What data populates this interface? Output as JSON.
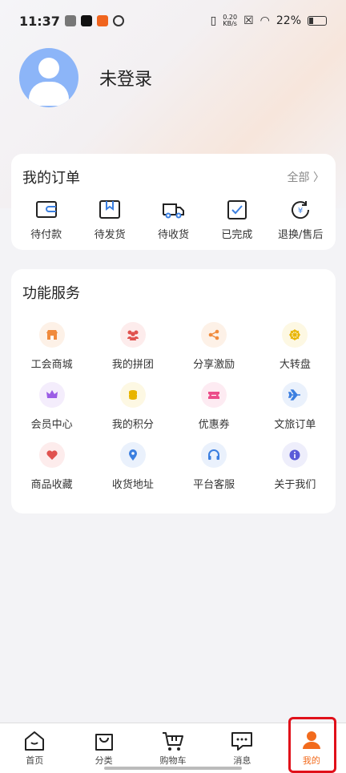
{
  "status_bar": {
    "time": "11:37",
    "net_speed_value": "0.20",
    "net_speed_unit": "KB/s",
    "battery": "22%"
  },
  "profile": {
    "login_text": "未登录"
  },
  "orders": {
    "title": "我的订单",
    "all_label": "全部 〉",
    "items": [
      {
        "label": "待付款",
        "icon": "wallet-icon"
      },
      {
        "label": "待发货",
        "icon": "package-icon"
      },
      {
        "label": "待收货",
        "icon": "truck-icon"
      },
      {
        "label": "已完成",
        "icon": "check-box-icon"
      },
      {
        "label": "退换/售后",
        "icon": "refund-icon"
      }
    ]
  },
  "services": {
    "title": "功能服务",
    "items": [
      {
        "label": "工会商城",
        "icon": "store-icon",
        "color": "#f08a3c",
        "bg": "#fdf1e7"
      },
      {
        "label": "我的拼团",
        "icon": "group-icon",
        "color": "#e0524f",
        "bg": "#fdecec"
      },
      {
        "label": "分享激励",
        "icon": "share-icon",
        "color": "#f08a3c",
        "bg": "#fdf1e7"
      },
      {
        "label": "大转盘",
        "icon": "wheel-icon",
        "color": "#e8b400",
        "bg": "#fdf8e3"
      },
      {
        "label": "会员中心",
        "icon": "crown-icon",
        "color": "#9b5de5",
        "bg": "#f4edfc"
      },
      {
        "label": "我的积分",
        "icon": "coins-icon",
        "color": "#e8b400",
        "bg": "#fdf8e3"
      },
      {
        "label": "优惠券",
        "icon": "coupon-icon",
        "color": "#ec4d8a",
        "bg": "#fdebf2"
      },
      {
        "label": "文旅订单",
        "icon": "plane-icon",
        "color": "#3b7fe0",
        "bg": "#eaf1fc"
      },
      {
        "label": "商品收藏",
        "icon": "heart-icon",
        "color": "#e0524f",
        "bg": "#fdecec"
      },
      {
        "label": "收货地址",
        "icon": "location-icon",
        "color": "#3b7fe0",
        "bg": "#eaf1fc"
      },
      {
        "label": "平台客服",
        "icon": "headset-icon",
        "color": "#3b7fe0",
        "bg": "#eaf1fc"
      },
      {
        "label": "关于我们",
        "icon": "info-icon",
        "color": "#5a5bd8",
        "bg": "#eeeefb"
      }
    ]
  },
  "tabbar": {
    "items": [
      {
        "label": "首页",
        "icon": "home-icon"
      },
      {
        "label": "分类",
        "icon": "bag-icon"
      },
      {
        "label": "购物车",
        "icon": "cart-icon"
      },
      {
        "label": "消息",
        "icon": "message-icon"
      },
      {
        "label": "我的",
        "icon": "profile-icon",
        "active": true
      }
    ],
    "active_color": "#f26b1d"
  }
}
